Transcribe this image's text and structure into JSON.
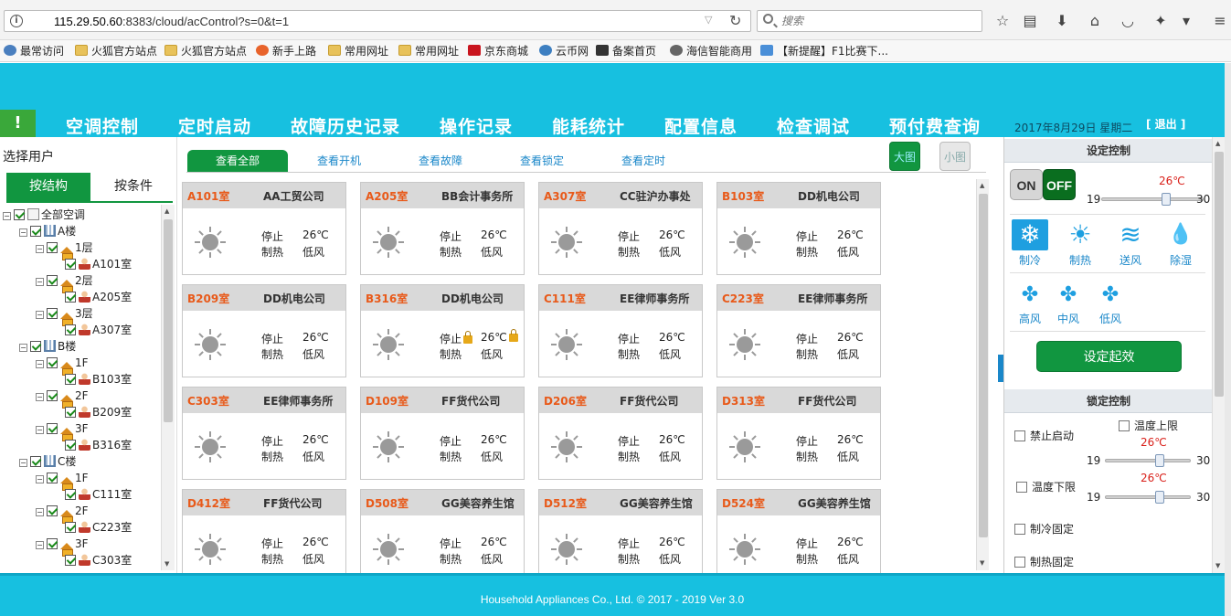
{
  "browser": {
    "url_prefix": "115.29.50.60",
    "url_rest": ":8383/cloud/acControl?s=0&t=1",
    "search_placeholder": "搜索",
    "bookmarks": [
      {
        "label": "最常访问",
        "icon": "gear"
      },
      {
        "label": "火狐官方站点",
        "icon": "folder"
      },
      {
        "label": "火狐官方站点",
        "icon": "folder"
      },
      {
        "label": "新手上路",
        "icon": "fox"
      },
      {
        "label": "常用网址",
        "icon": "folder"
      },
      {
        "label": "常用网址",
        "icon": "folder"
      },
      {
        "label": "京东商城",
        "icon": "jd"
      },
      {
        "label": "云币网",
        "icon": "cloud"
      },
      {
        "label": "备案首页",
        "icon": "ca"
      },
      {
        "label": "海信智能商用",
        "icon": "globe"
      },
      {
        "label": "【新提醒】F1比赛下...",
        "icon": "s2"
      }
    ]
  },
  "header": {
    "nav": [
      "空调控制",
      "定时启动",
      "故障历史记录",
      "操作记录",
      "能耗统计",
      "配置信息",
      "检查调试",
      "预付费查询"
    ],
    "date": "2017年8月29日 星期二",
    "logout": "[ 退出 ]",
    "alert": "!"
  },
  "left": {
    "title": "选择用户",
    "tab_structure": "按结构",
    "tab_condition": "按条件",
    "tree": [
      {
        "level": 0,
        "label": "全部空调",
        "icon": "doc"
      },
      {
        "level": 1,
        "label": "A楼",
        "icon": "building"
      },
      {
        "level": 2,
        "label": "1层",
        "icon": "house"
      },
      {
        "level": 3,
        "label": "A101室",
        "icon": "person"
      },
      {
        "level": 2,
        "label": "2层",
        "icon": "house"
      },
      {
        "level": 3,
        "label": "A205室",
        "icon": "person"
      },
      {
        "level": 2,
        "label": "3层",
        "icon": "house"
      },
      {
        "level": 3,
        "label": "A307室",
        "icon": "person"
      },
      {
        "level": 1,
        "label": "B楼",
        "icon": "building"
      },
      {
        "level": 2,
        "label": "1F",
        "icon": "house"
      },
      {
        "level": 3,
        "label": "B103室",
        "icon": "person"
      },
      {
        "level": 2,
        "label": "2F",
        "icon": "house"
      },
      {
        "level": 3,
        "label": "B209室",
        "icon": "person"
      },
      {
        "level": 2,
        "label": "3F",
        "icon": "house"
      },
      {
        "level": 3,
        "label": "B316室",
        "icon": "person"
      },
      {
        "level": 1,
        "label": "C楼",
        "icon": "building"
      },
      {
        "level": 2,
        "label": "1F",
        "icon": "house"
      },
      {
        "level": 3,
        "label": "C111室",
        "icon": "person"
      },
      {
        "level": 2,
        "label": "2F",
        "icon": "house"
      },
      {
        "level": 3,
        "label": "C223室",
        "icon": "person"
      },
      {
        "level": 2,
        "label": "3F",
        "icon": "house"
      },
      {
        "level": 3,
        "label": "C303室",
        "icon": "person"
      }
    ]
  },
  "main": {
    "filters": [
      "查看全部",
      "查看开机",
      "查看故障",
      "查看锁定",
      "查看定时"
    ],
    "view_big": "大图",
    "view_small": "小图",
    "cards": [
      {
        "room": "A101室",
        "company": "AA工贸公司",
        "state": "停止",
        "temp": "26℃",
        "mode": "制热",
        "fan": "低风",
        "locked": false
      },
      {
        "room": "A205室",
        "company": "BB会计事务所",
        "state": "停止",
        "temp": "26℃",
        "mode": "制热",
        "fan": "低风",
        "locked": false
      },
      {
        "room": "A307室",
        "company": "CC驻沪办事处",
        "state": "停止",
        "temp": "26℃",
        "mode": "制热",
        "fan": "低风",
        "locked": false
      },
      {
        "room": "B103室",
        "company": "DD机电公司",
        "state": "停止",
        "temp": "26℃",
        "mode": "制热",
        "fan": "低风",
        "locked": false
      },
      {
        "room": "B209室",
        "company": "DD机电公司",
        "state": "停止",
        "temp": "26℃",
        "mode": "制热",
        "fan": "低风",
        "locked": false
      },
      {
        "room": "B316室",
        "company": "DD机电公司",
        "state": "停止",
        "temp": "26℃",
        "mode": "制热",
        "fan": "低风",
        "locked": true
      },
      {
        "room": "C111室",
        "company": "EE律师事务所",
        "state": "停止",
        "temp": "26℃",
        "mode": "制热",
        "fan": "低风",
        "locked": false
      },
      {
        "room": "C223室",
        "company": "EE律师事务所",
        "state": "停止",
        "temp": "26℃",
        "mode": "制热",
        "fan": "低风",
        "locked": false
      },
      {
        "room": "C303室",
        "company": "EE律师事务所",
        "state": "停止",
        "temp": "26℃",
        "mode": "制热",
        "fan": "低风",
        "locked": false
      },
      {
        "room": "D109室",
        "company": "FF货代公司",
        "state": "停止",
        "temp": "26℃",
        "mode": "制热",
        "fan": "低风",
        "locked": false
      },
      {
        "room": "D206室",
        "company": "FF货代公司",
        "state": "停止",
        "temp": "26℃",
        "mode": "制热",
        "fan": "低风",
        "locked": false
      },
      {
        "room": "D313室",
        "company": "FF货代公司",
        "state": "停止",
        "temp": "26℃",
        "mode": "制热",
        "fan": "低风",
        "locked": false
      },
      {
        "room": "D412室",
        "company": "FF货代公司",
        "state": "停止",
        "temp": "26℃",
        "mode": "制热",
        "fan": "低风",
        "locked": false
      },
      {
        "room": "D508室",
        "company": "GG美容养生馆",
        "state": "停止",
        "temp": "26℃",
        "mode": "制热",
        "fan": "低风",
        "locked": false
      },
      {
        "room": "D512室",
        "company": "GG美容养生馆",
        "state": "停止",
        "temp": "26℃",
        "mode": "制热",
        "fan": "低风",
        "locked": false
      },
      {
        "room": "D524室",
        "company": "GG美容养生馆",
        "state": "停止",
        "temp": "26℃",
        "mode": "制热",
        "fan": "低风",
        "locked": false
      }
    ]
  },
  "right": {
    "setting_title": "设定控制",
    "on": "ON",
    "off": "OFF",
    "set_temp": "26℃",
    "set_temp_value": 26,
    "slider_min": "19",
    "slider_max": "30",
    "modes": [
      {
        "label": "制冷",
        "icon": "snowflake",
        "active": true
      },
      {
        "label": "制热",
        "icon": "sun",
        "active": false
      },
      {
        "label": "送风",
        "icon": "wind",
        "active": false
      },
      {
        "label": "除湿",
        "icon": "droplet",
        "active": false
      }
    ],
    "fans": [
      {
        "label": "高风",
        "icon": "fan-high"
      },
      {
        "label": "中风",
        "icon": "fan-mid"
      },
      {
        "label": "低风",
        "icon": "fan-low"
      }
    ],
    "apply": "设定起效",
    "lock_title": "锁定控制",
    "forbid_start": "禁止启动",
    "temp_upper": "温度上限",
    "upper_temp": "26℃",
    "upper_value": 26,
    "temp_lower": "温度下限",
    "lower_temp": "26℃",
    "lower_value": 26,
    "cool_fixed": "制冷固定",
    "heat_fixed": "制热固定"
  },
  "footer": {
    "text": "Household Appliances Co., Ltd. © 2017 - 2019 Ver 3.0"
  },
  "colors": {
    "header": "#17c0e0",
    "green": "#119640",
    "room_label": "#e85a1a",
    "accent_blue": "#1e9fe0",
    "temp_red": "#d9201a"
  }
}
